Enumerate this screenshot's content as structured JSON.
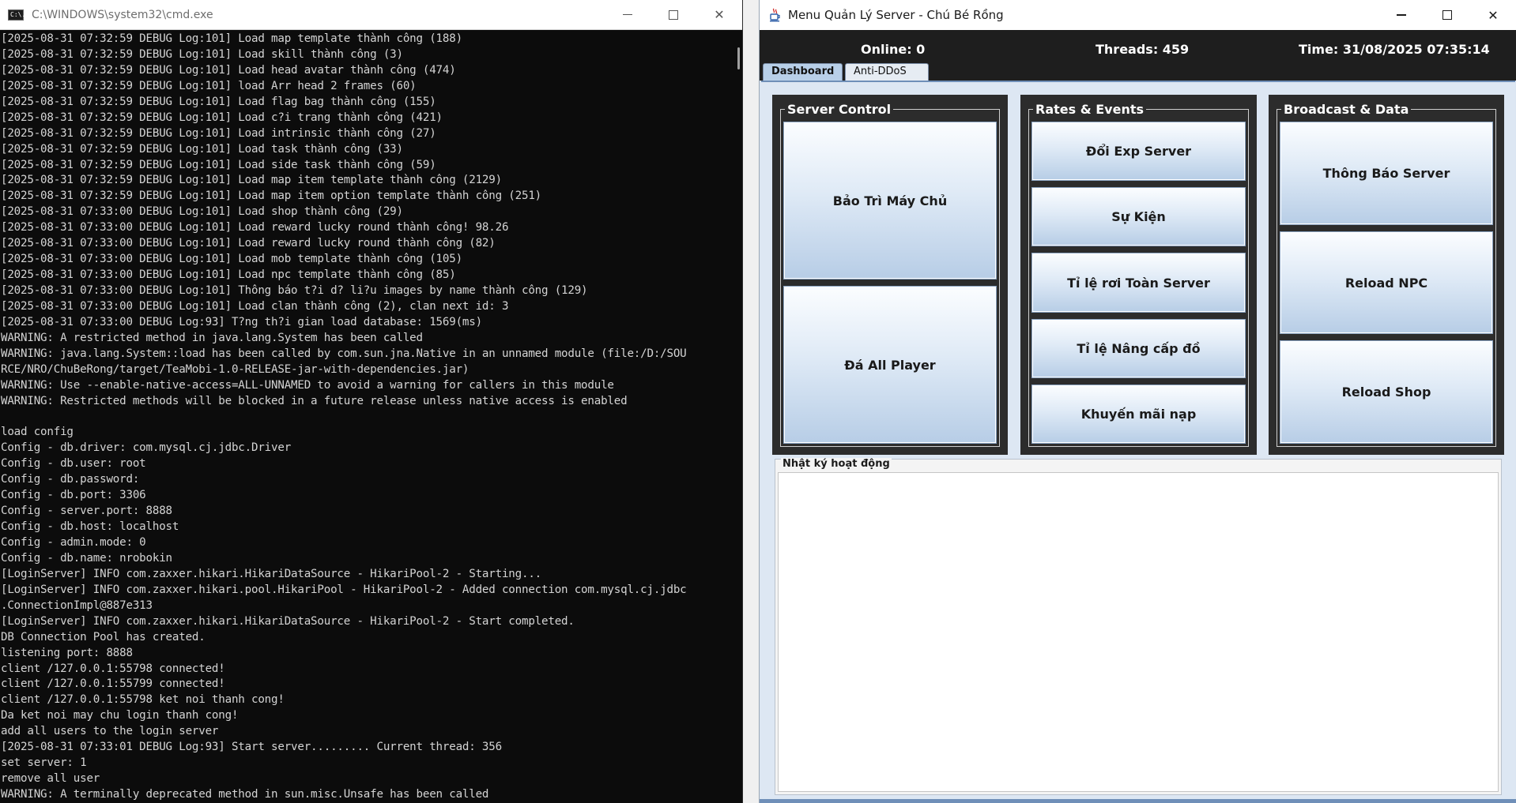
{
  "cmd": {
    "title": "C:\\WINDOWS\\system32\\cmd.exe",
    "icon_text": "C:\\.",
    "lines": [
      "[2025-08-31 07:32:59 DEBUG Log:101] Load map template thành công (188)",
      "[2025-08-31 07:32:59 DEBUG Log:101] Load skill thành công (3)",
      "[2025-08-31 07:32:59 DEBUG Log:101] Load head avatar thành công (474)",
      "[2025-08-31 07:32:59 DEBUG Log:101] load Arr head 2 frames (60)",
      "[2025-08-31 07:32:59 DEBUG Log:101] Load flag bag thành công (155)",
      "[2025-08-31 07:32:59 DEBUG Log:101] Load c?i trang thành công (421)",
      "[2025-08-31 07:32:59 DEBUG Log:101] Load intrinsic thành công (27)",
      "[2025-08-31 07:32:59 DEBUG Log:101] Load task thành công (33)",
      "[2025-08-31 07:32:59 DEBUG Log:101] Load side task thành công (59)",
      "[2025-08-31 07:32:59 DEBUG Log:101] Load map item template thành công (2129)",
      "[2025-08-31 07:32:59 DEBUG Log:101] Load map item option template thành công (251)",
      "[2025-08-31 07:33:00 DEBUG Log:101] Load shop thành công (29)",
      "[2025-08-31 07:33:00 DEBUG Log:101] Load reward lucky round thành công! 98.26",
      "[2025-08-31 07:33:00 DEBUG Log:101] Load reward lucky round thành công (82)",
      "[2025-08-31 07:33:00 DEBUG Log:101] Load mob template thành công (105)",
      "[2025-08-31 07:33:00 DEBUG Log:101] Load npc template thành công (85)",
      "[2025-08-31 07:33:00 DEBUG Log:101] Thông báo t?i d? li?u images by name thành công (129)",
      "[2025-08-31 07:33:00 DEBUG Log:101] Load clan thành công (2), clan next id: 3",
      "[2025-08-31 07:33:00 DEBUG Log:93] T?ng th?i gian load database: 1569(ms)",
      "WARNING: A restricted method in java.lang.System has been called",
      "WARNING: java.lang.System::load has been called by com.sun.jna.Native in an unnamed module (file:/D:/SOU",
      "RCE/NRO/ChuBeRong/target/TeaMobi-1.0-RELEASE-jar-with-dependencies.jar)",
      "WARNING: Use --enable-native-access=ALL-UNNAMED to avoid a warning for callers in this module",
      "WARNING: Restricted methods will be blocked in a future release unless native access is enabled",
      "",
      "load config",
      "Config - db.driver: com.mysql.cj.jdbc.Driver",
      "Config - db.user: root",
      "Config - db.password:",
      "Config - db.port: 3306",
      "Config - server.port: 8888",
      "Config - db.host: localhost",
      "Config - admin.mode: 0",
      "Config - db.name: nrobokin",
      "[LoginServer] INFO com.zaxxer.hikari.HikariDataSource - HikariPool-2 - Starting...",
      "[LoginServer] INFO com.zaxxer.hikari.pool.HikariPool - HikariPool-2 - Added connection com.mysql.cj.jdbc",
      ".ConnectionImpl@887e313",
      "[LoginServer] INFO com.zaxxer.hikari.HikariDataSource - HikariPool-2 - Start completed.",
      "DB Connection Pool has created.",
      "listening port: 8888",
      "client /127.0.0.1:55798 connected!",
      "client /127.0.0.1:55799 connected!",
      "client /127.0.0.1:55798 ket noi thanh cong!",
      "Da ket noi may chu login thanh cong!",
      "add all users to the login server",
      "[2025-08-31 07:33:01 DEBUG Log:93] Start server......... Current thread: 356",
      "set server: 1",
      "remove all user",
      "WARNING: A terminally deprecated method in sun.misc.Unsafe has been called"
    ]
  },
  "manager": {
    "title": "Menu Quản Lý Server - Chú Bé Rồng",
    "status": {
      "online": "Online: 0",
      "threads": "Threads: 459",
      "time": "Time: 31/08/2025 07:35:14"
    },
    "tabs": [
      "Dashboard",
      "Anti-DDoS"
    ],
    "panels": {
      "server_control": {
        "title": "Server Control",
        "buttons": [
          "Bảo Trì Máy Chủ",
          "Đá All Player"
        ]
      },
      "rates_events": {
        "title": "Rates & Events",
        "buttons": [
          "Đổi Exp Server",
          "Sự Kiện",
          "Tỉ lệ rơi Toàn Server",
          "Tỉ lệ Nâng cấp đồ",
          "Khuyến mãi nạp"
        ]
      },
      "broadcast_data": {
        "title": "Broadcast & Data",
        "buttons": [
          "Thông Báo Server",
          "Reload NPC",
          "Reload Shop"
        ]
      }
    },
    "activity_log": {
      "title": "Nhật ký hoạt động"
    }
  },
  "icons": {
    "cmd_icon": "terminal-icon",
    "mgr_icon": "java-cup-icon",
    "minimize": "minimize-icon",
    "maximize": "maximize-icon",
    "close": "close-icon"
  },
  "colors": {
    "console_bg": "#0c0c0c",
    "console_text": "#d4d4d4",
    "status_bar_bg": "#1e1e1e",
    "panel_bg": "#2c2c2c",
    "button_gradient_top": "#fbfdff",
    "button_gradient_bottom": "#b7cde6",
    "tab_active_bg": "#b8cfe8"
  }
}
